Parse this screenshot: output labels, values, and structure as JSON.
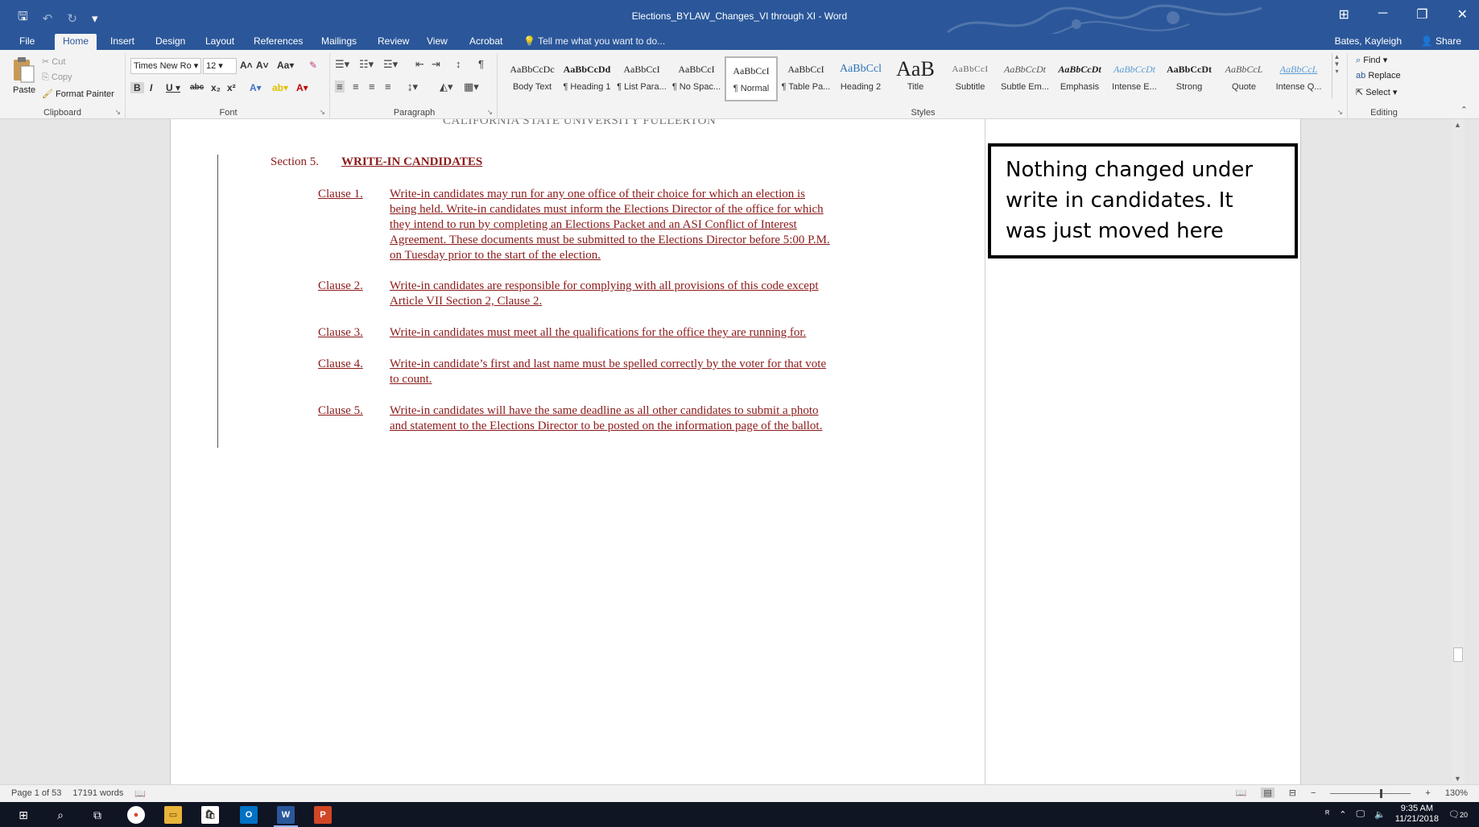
{
  "window": {
    "title": "Elections_BYLAW_Changes_VI through XI - Word",
    "controls": [
      "⊞",
      "─",
      "❐",
      "✕"
    ]
  },
  "qat": {
    "save": "🖫",
    "undo": "↶",
    "redo": "↻",
    "more": "▾"
  },
  "tabs": [
    "File",
    "Home",
    "Insert",
    "Design",
    "Layout",
    "References",
    "Mailings",
    "Review",
    "View",
    "Acrobat"
  ],
  "tell_me": "Tell me what you want to do...",
  "user": "Bates, Kayleigh",
  "share": "Share",
  "ribbon": {
    "clipboard": {
      "paste": "Paste",
      "cut": "Cut",
      "copy": "Copy",
      "format_painter": "Format Painter",
      "label": "Clipboard"
    },
    "font": {
      "name": "Times New Ro",
      "size": "12",
      "label": "Font"
    },
    "paragraph": {
      "label": "Paragraph"
    },
    "styles": {
      "label": "Styles",
      "items": [
        {
          "sample": "AaBbCcDc",
          "name": "Body Text"
        },
        {
          "sample": "AaBbCcDd",
          "name": "¶ Heading 1"
        },
        {
          "sample": "AaBbCcI",
          "name": "¶ List Para..."
        },
        {
          "sample": "AaBbCcI",
          "name": "¶ No Spac..."
        },
        {
          "sample": "AaBbCcI",
          "name": "¶ Normal"
        },
        {
          "sample": "AaBbCcI",
          "name": "¶ Table Pa..."
        },
        {
          "sample": "AaBbCcl",
          "name": "Heading 2"
        },
        {
          "sample": "AaB",
          "name": "Title"
        },
        {
          "sample": "AaBbCcI",
          "name": "Subtitle"
        },
        {
          "sample": "AaBbCcDt",
          "name": "Subtle Em..."
        },
        {
          "sample": "AaBbCcDt",
          "name": "Emphasis"
        },
        {
          "sample": "AaBbCcDt",
          "name": "Intense E..."
        },
        {
          "sample": "AaBbCcDt",
          "name": "Strong"
        },
        {
          "sample": "AaBbCcL",
          "name": "Quote"
        },
        {
          "sample": "AaBbCcL",
          "name": "Intense Q..."
        }
      ]
    },
    "editing": {
      "find": "Find",
      "replace": "Replace",
      "select": "Select",
      "label": "Editing"
    }
  },
  "document": {
    "header": "CALIFORNIA STATE UNIVERSITY FULLERTON",
    "section_number": "Section 5.",
    "section_title": "WRITE-IN CANDIDATES",
    "clauses": [
      {
        "label": "Clause 1.",
        "lines": [
          "Write-in candidates may run for any one office of their choice for which an election is",
          "being held. Write-in candidates must inform the Elections Director of the office for which",
          "they intend to run by completing an Elections Packet and an ASI Conflict of Interest",
          "Agreement. These documents must be submitted to the Elections Director before 5:00 P.M.",
          "on Tuesday prior to the start of the election."
        ]
      },
      {
        "label": "Clause 2.",
        "lines": [
          "Write-in candidates are responsible for complying with all provisions of this code except",
          "Article VII Section 2, Clause 2."
        ]
      },
      {
        "label": "Clause 3.",
        "lines": [
          "Write-in candidates must meet all the qualifications for the office they are running for."
        ]
      },
      {
        "label": "Clause 4.",
        "lines": [
          "Write-in candidate’s first and last name must be spelled correctly by the voter for that vote",
          "to count."
        ]
      },
      {
        "label": "Clause 5.",
        "lines": [
          "Write-in candidates will have the same deadline as all other candidates to submit a photo",
          "and statement to the Elections Director to be posted on the information page of the ballot."
        ]
      }
    ],
    "comment": "Nothing changed under write in candidates. It was just moved here"
  },
  "status": {
    "page": "Page 1 of 53",
    "words": "17191 words",
    "zoom": "130%"
  },
  "taskbar": {
    "time": "9:35 AM",
    "date": "11/21/2018",
    "notifications": "20"
  },
  "colors": {
    "title_bar": "#2b579a",
    "revision": "#8b1a1a",
    "taskbar": "#101523"
  }
}
